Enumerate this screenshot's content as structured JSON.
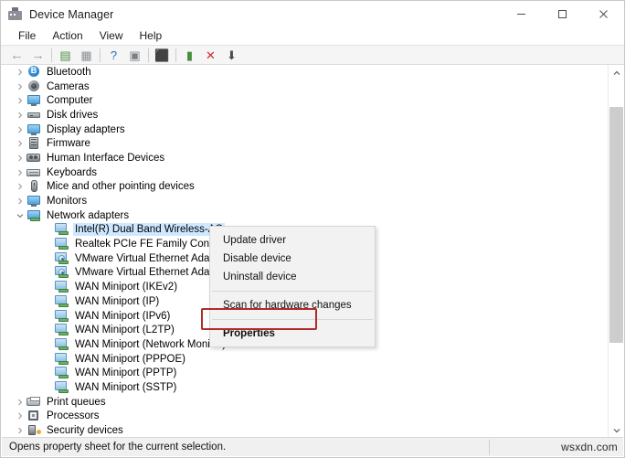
{
  "window": {
    "title": "Device Manager",
    "icon": "device-manager-icon",
    "controls": {
      "minimize": "minimize-icon",
      "maximize": "maximize-icon",
      "close": "close-icon"
    }
  },
  "menubar": {
    "items": [
      {
        "label": "File"
      },
      {
        "label": "Action"
      },
      {
        "label": "View"
      },
      {
        "label": "Help"
      }
    ]
  },
  "toolbar": {
    "buttons": [
      {
        "name": "back-icon",
        "glyph": "←",
        "color": "#9aa0a6"
      },
      {
        "name": "forward-icon",
        "glyph": "→",
        "color": "#9aa0a6"
      },
      {
        "name": "show-hide-console-tree-icon",
        "glyph": "▤",
        "color": "#4a8c3f"
      },
      {
        "name": "properties-icon",
        "glyph": "▦",
        "color": "#8a9097"
      },
      {
        "name": "help-icon",
        "glyph": "?",
        "color": "#1b6fc4"
      },
      {
        "name": "update-driver-icon",
        "glyph": "▣",
        "color": "#7b8288"
      },
      {
        "name": "scan-for-hardware-changes-icon",
        "glyph": "⬛",
        "color": "#3b8fd4"
      },
      {
        "name": "enable-device-icon",
        "glyph": "▮",
        "color": "#4a8c3f"
      },
      {
        "name": "uninstall-device-icon",
        "glyph": "✕",
        "color": "#cc2b2b"
      },
      {
        "name": "install-legacy-hardware-icon",
        "glyph": "⬇",
        "color": "#4d4d4d"
      }
    ]
  },
  "tree": {
    "items": [
      {
        "label": "Bluetooth",
        "icon": "bluetooth-icon",
        "level": 1,
        "expanded": false,
        "selected": false
      },
      {
        "label": "Cameras",
        "icon": "camera-icon",
        "level": 1,
        "expanded": false,
        "selected": false
      },
      {
        "label": "Computer",
        "icon": "computer-icon",
        "level": 1,
        "expanded": false,
        "selected": false
      },
      {
        "label": "Disk drives",
        "icon": "disk-drive-icon",
        "level": 1,
        "expanded": false,
        "selected": false
      },
      {
        "label": "Display adapters",
        "icon": "display-adapter-icon",
        "level": 1,
        "expanded": false,
        "selected": false
      },
      {
        "label": "Firmware",
        "icon": "firmware-icon",
        "level": 1,
        "expanded": false,
        "selected": false
      },
      {
        "label": "Human Interface Devices",
        "icon": "hid-icon",
        "level": 1,
        "expanded": false,
        "selected": false
      },
      {
        "label": "Keyboards",
        "icon": "keyboard-icon",
        "level": 1,
        "expanded": false,
        "selected": false
      },
      {
        "label": "Mice and other pointing devices",
        "icon": "mouse-icon",
        "level": 1,
        "expanded": false,
        "selected": false
      },
      {
        "label": "Monitors",
        "icon": "monitor-icon",
        "level": 1,
        "expanded": false,
        "selected": false
      },
      {
        "label": "Network adapters",
        "icon": "network-adapter-icon",
        "level": 1,
        "expanded": true,
        "selected": false
      },
      {
        "label": "Intel(R) Dual Band Wireless-AC",
        "icon": "nic-icon",
        "level": 2,
        "expanded": null,
        "selected": true
      },
      {
        "label": "Realtek PCIe FE Family Contro",
        "icon": "nic-icon",
        "level": 2,
        "expanded": null,
        "selected": false
      },
      {
        "label": "VMware Virtual Ethernet Adap",
        "icon": "nic-virtual-icon",
        "level": 2,
        "expanded": null,
        "selected": false
      },
      {
        "label": "VMware Virtual Ethernet Adap",
        "icon": "nic-virtual-icon",
        "level": 2,
        "expanded": null,
        "selected": false
      },
      {
        "label": "WAN Miniport (IKEv2)",
        "icon": "nic-icon",
        "level": 2,
        "expanded": null,
        "selected": false
      },
      {
        "label": "WAN Miniport (IP)",
        "icon": "nic-icon",
        "level": 2,
        "expanded": null,
        "selected": false
      },
      {
        "label": "WAN Miniport (IPv6)",
        "icon": "nic-icon",
        "level": 2,
        "expanded": null,
        "selected": false
      },
      {
        "label": "WAN Miniport (L2TP)",
        "icon": "nic-icon",
        "level": 2,
        "expanded": null,
        "selected": false
      },
      {
        "label": "WAN Miniport (Network Monitor)",
        "icon": "nic-icon",
        "level": 2,
        "expanded": null,
        "selected": false
      },
      {
        "label": "WAN Miniport (PPPOE)",
        "icon": "nic-icon",
        "level": 2,
        "expanded": null,
        "selected": false
      },
      {
        "label": "WAN Miniport (PPTP)",
        "icon": "nic-icon",
        "level": 2,
        "expanded": null,
        "selected": false
      },
      {
        "label": "WAN Miniport (SSTP)",
        "icon": "nic-icon",
        "level": 2,
        "expanded": null,
        "selected": false
      },
      {
        "label": "Print queues",
        "icon": "printer-icon",
        "level": 1,
        "expanded": false,
        "selected": false
      },
      {
        "label": "Processors",
        "icon": "processor-icon",
        "level": 1,
        "expanded": false,
        "selected": false
      },
      {
        "label": "Security devices",
        "icon": "security-device-icon",
        "level": 1,
        "expanded": false,
        "selected": false
      }
    ]
  },
  "context_menu": {
    "items": [
      {
        "label": "Update driver",
        "bold": false,
        "separator_after": false
      },
      {
        "label": "Disable device",
        "bold": false,
        "separator_after": false
      },
      {
        "label": "Uninstall device",
        "bold": false,
        "separator_after": true
      },
      {
        "label": "Scan for hardware changes",
        "bold": false,
        "separator_after": true
      },
      {
        "label": "Properties",
        "bold": true,
        "separator_after": false
      }
    ],
    "highlight_color": "#b02b2b",
    "highlighted_item": "Properties"
  },
  "statusbar": {
    "text": "Opens property sheet for the current selection.",
    "watermark": "wsxdn.com"
  }
}
